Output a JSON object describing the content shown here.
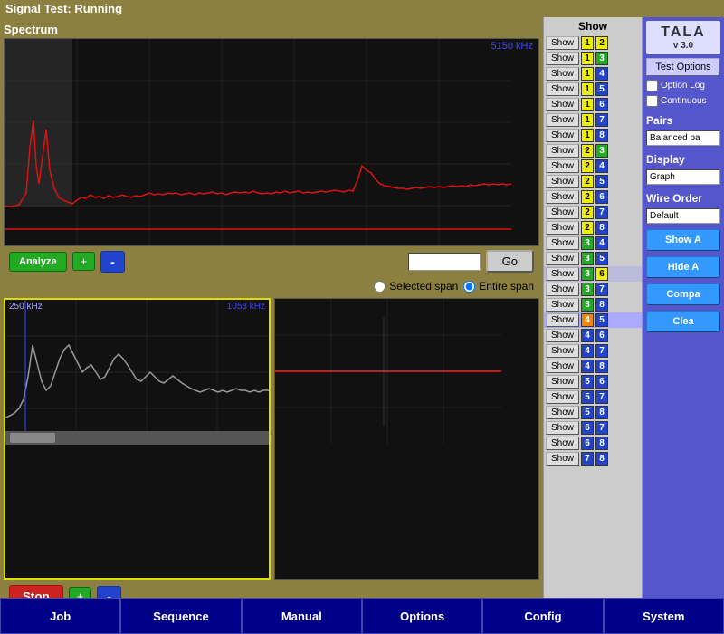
{
  "title": "Signal Test: Running",
  "subtitle": "Spectrum",
  "main_freq": "5150 kHz",
  "sub_freq_left": "250 kHz",
  "sub_freq_right": "1053 kHz",
  "go_button": "Go",
  "span_options": {
    "selected": "Selected span",
    "entire": "Entire span"
  },
  "controls": {
    "plus": "+",
    "minus": "-",
    "stop": "Stop",
    "analyze": "Analyze"
  },
  "show_panel": {
    "header": "Show",
    "rows": [
      {
        "label": "Show",
        "b1": "1",
        "b2": "2",
        "c1": "yellow",
        "c2": "yellow"
      },
      {
        "label": "Show",
        "b1": "1",
        "b2": "3",
        "c1": "yellow",
        "c2": "green"
      },
      {
        "label": "Show",
        "b1": "1",
        "b2": "4",
        "c1": "yellow",
        "c2": "blue"
      },
      {
        "label": "Show",
        "b1": "1",
        "b2": "5",
        "c1": "yellow",
        "c2": "blue"
      },
      {
        "label": "Show",
        "b1": "1",
        "b2": "6",
        "c1": "yellow",
        "c2": "blue"
      },
      {
        "label": "Show",
        "b1": "1",
        "b2": "7",
        "c1": "yellow",
        "c2": "blue"
      },
      {
        "label": "Show",
        "b1": "1",
        "b2": "8",
        "c1": "yellow",
        "c2": "blue"
      },
      {
        "label": "Show",
        "b1": "2",
        "b2": "3",
        "c1": "yellow",
        "c2": "green"
      },
      {
        "label": "Show",
        "b1": "2",
        "b2": "4",
        "c1": "yellow",
        "c2": "blue"
      },
      {
        "label": "Show",
        "b1": "2",
        "b2": "5",
        "c1": "yellow",
        "c2": "blue"
      },
      {
        "label": "Show",
        "b1": "2",
        "b2": "6",
        "c1": "yellow",
        "c2": "blue"
      },
      {
        "label": "Show",
        "b1": "2",
        "b2": "7",
        "c1": "yellow",
        "c2": "blue"
      },
      {
        "label": "Show",
        "b1": "2",
        "b2": "8",
        "c1": "yellow",
        "c2": "blue"
      },
      {
        "label": "Show",
        "b1": "3",
        "b2": "4",
        "c1": "green",
        "c2": "blue"
      },
      {
        "label": "Show",
        "b1": "3",
        "b2": "5",
        "c1": "green",
        "c2": "blue"
      },
      {
        "label": "Show",
        "b1": "3",
        "b2": "6",
        "c1": "green",
        "c2": "yellow",
        "highlight": true
      },
      {
        "label": "Show",
        "b1": "3",
        "b2": "7",
        "c1": "green",
        "c2": "blue"
      },
      {
        "label": "Show",
        "b1": "3",
        "b2": "8",
        "c1": "green",
        "c2": "blue"
      },
      {
        "label": "Show",
        "b1": "4",
        "b2": "5",
        "c1": "orange",
        "c2": "blue",
        "selected": true
      },
      {
        "label": "Show",
        "b1": "4",
        "b2": "6",
        "c1": "blue",
        "c2": "blue"
      },
      {
        "label": "Show",
        "b1": "4",
        "b2": "7",
        "c1": "blue",
        "c2": "blue"
      },
      {
        "label": "Show",
        "b1": "4",
        "b2": "8",
        "c1": "blue",
        "c2": "blue"
      },
      {
        "label": "Show",
        "b1": "5",
        "b2": "6",
        "c1": "blue",
        "c2": "blue"
      },
      {
        "label": "Show",
        "b1": "5",
        "b2": "7",
        "c1": "blue",
        "c2": "blue"
      },
      {
        "label": "Show",
        "b1": "5",
        "b2": "8",
        "c1": "blue",
        "c2": "blue"
      },
      {
        "label": "Show",
        "b1": "6",
        "b2": "7",
        "c1": "blue",
        "c2": "blue"
      },
      {
        "label": "Show",
        "b1": "6",
        "b2": "8",
        "c1": "blue",
        "c2": "blue"
      },
      {
        "label": "Show",
        "b1": "7",
        "b2": "8",
        "c1": "blue",
        "c2": "blue"
      }
    ]
  },
  "right_panel": {
    "tala_title": "TALA",
    "tala_version": "v 3.0",
    "test_options_btn": "Test Options",
    "option_log": "Option Log",
    "continuous": "Continuous",
    "pairs_label": "Pairs",
    "pairs_value": "Balanced pa",
    "display_label": "Display",
    "display_value": "Graph",
    "wire_order_label": "Wire Order",
    "wire_order_value": "Default",
    "show_all_btn": "Show A",
    "hide_all_btn": "Hide A",
    "compare_btn": "Compa",
    "clear_btn": "Clea"
  },
  "bottom_nav": {
    "items": [
      "Job",
      "Sequence",
      "Manual",
      "Options",
      "Config",
      "System"
    ]
  }
}
